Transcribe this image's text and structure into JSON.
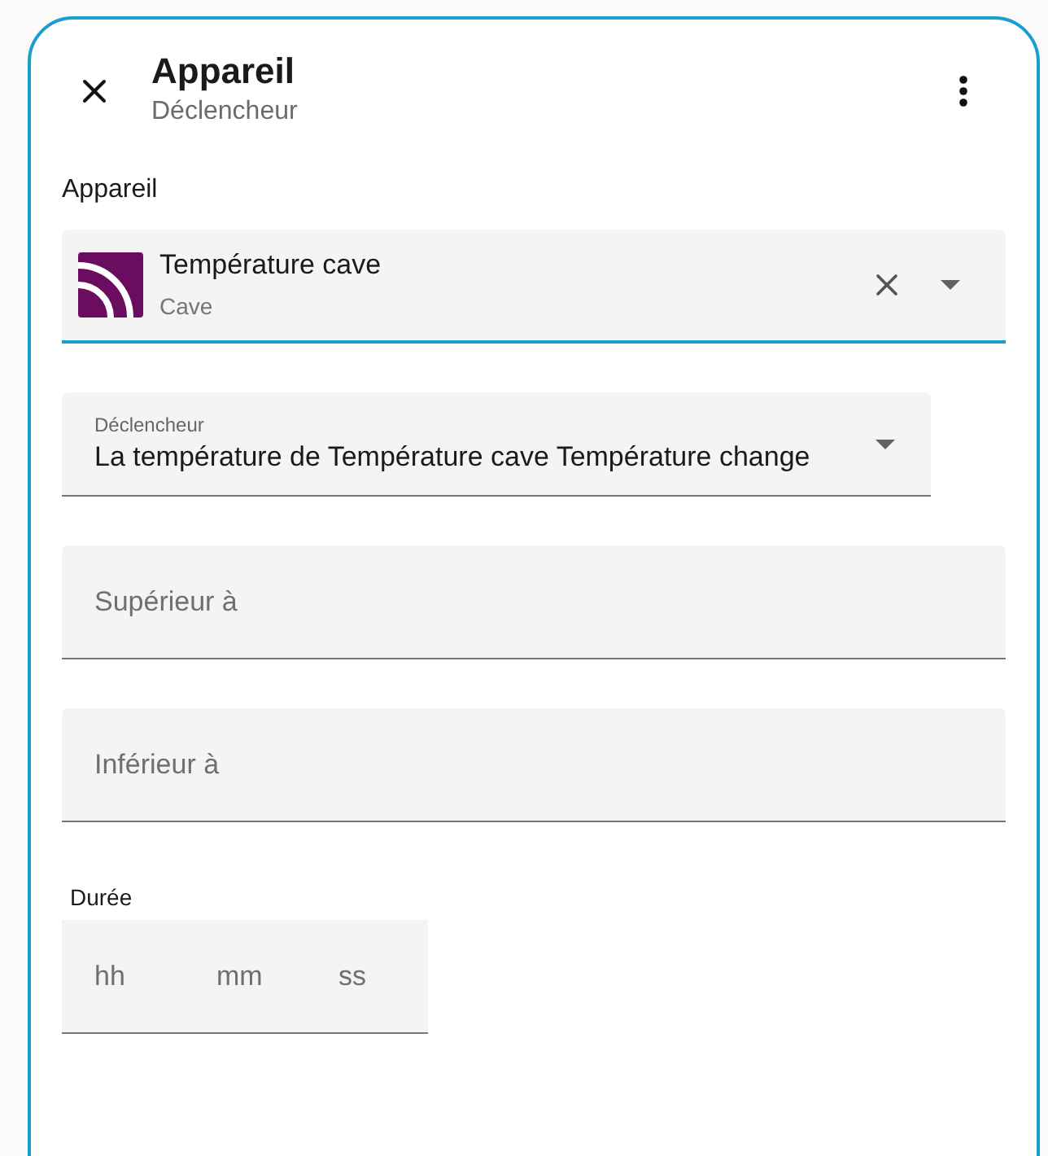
{
  "header": {
    "title": "Appareil",
    "subtitle": "Déclencheur"
  },
  "device_picker": {
    "label": "Appareil",
    "value": "Température cave",
    "secondary": "Cave",
    "focused": true
  },
  "trigger_select": {
    "label": "Déclencheur",
    "value": "La température de Température cave Température change"
  },
  "fields": [
    {
      "placeholder": "Supérieur à"
    },
    {
      "placeholder": "Inférieur à"
    }
  ],
  "duration": {
    "label": "Durée",
    "placeholders": [
      "hh",
      "mm",
      "ss"
    ]
  }
}
